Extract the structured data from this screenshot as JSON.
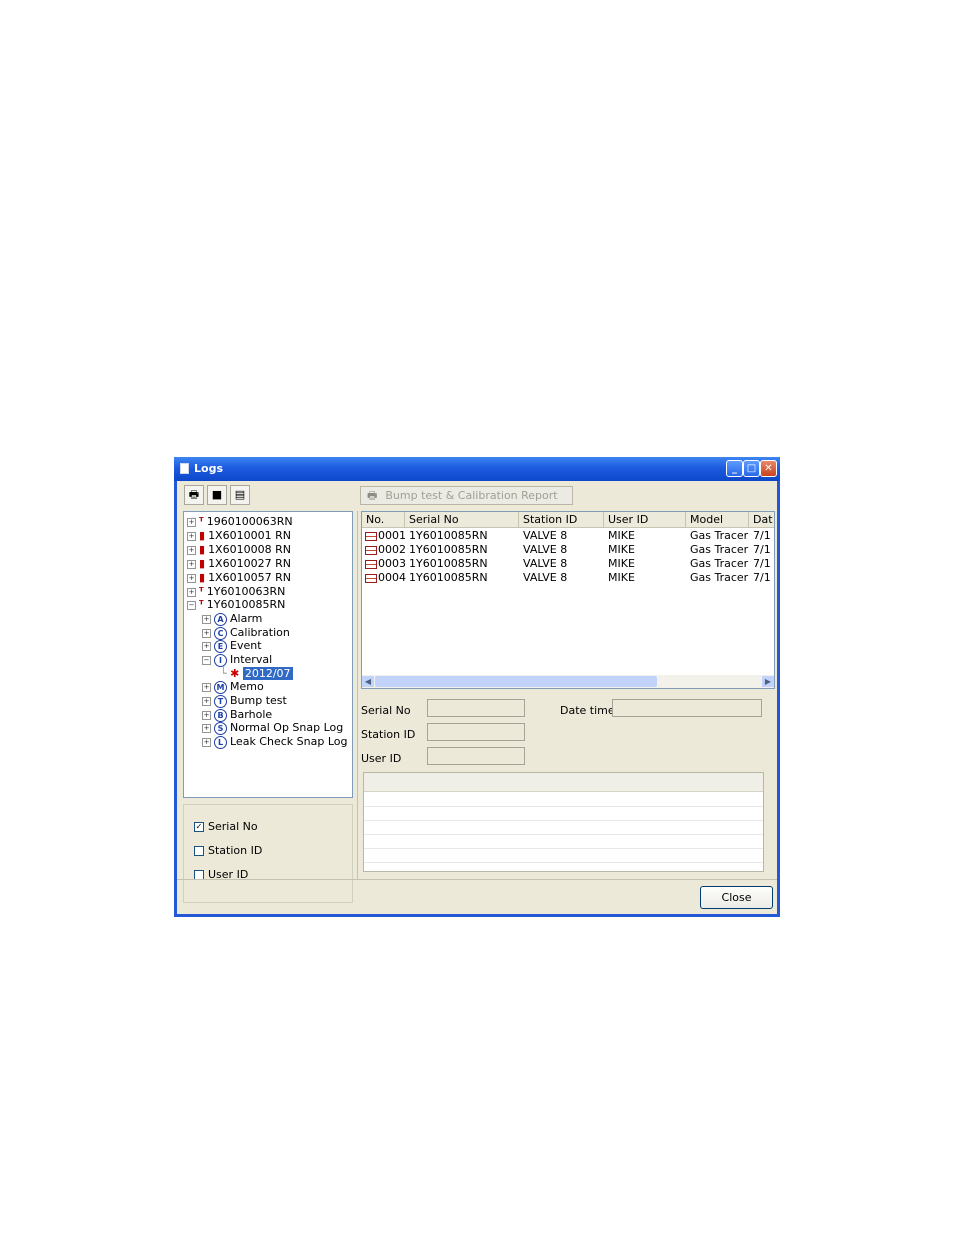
{
  "window": {
    "title": "Logs",
    "minimize": "_",
    "maximize": "□",
    "close": "✕"
  },
  "toolbar": {
    "print_icon": "print-icon",
    "save_icon": "save-icon",
    "clipboard_icon": "clipboard-icon",
    "report_button": "Bump test & Calibration Report"
  },
  "tree": {
    "devices": [
      "1960100063RN",
      "1X6010001 RN",
      "1X6010008 RN",
      "1X6010027 RN",
      "1X6010057 RN",
      "1Y6010063RN",
      "1Y6010085RN"
    ],
    "categories": [
      {
        "letter": "A",
        "label": "Alarm"
      },
      {
        "letter": "C",
        "label": "Calibration"
      },
      {
        "letter": "E",
        "label": "Event"
      },
      {
        "letter": "I",
        "label": "Interval"
      },
      {
        "letter": "M",
        "label": "Memo"
      },
      {
        "letter": "T",
        "label": "Bump test"
      },
      {
        "letter": "B",
        "label": "Barhole"
      },
      {
        "letter": "S",
        "label": "Normal Op Snap Log"
      },
      {
        "letter": "L",
        "label": "Leak Check Snap Log"
      }
    ],
    "selected_leaf": "2012/07"
  },
  "filters": [
    {
      "label": "Serial No",
      "checked": true
    },
    {
      "label": "Station ID",
      "checked": false
    },
    {
      "label": "User ID",
      "checked": false
    }
  ],
  "list": {
    "headers": [
      "No.",
      "Serial No",
      "Station ID",
      "User ID",
      "Model",
      "Dat"
    ],
    "rows": [
      [
        "0001",
        "1Y6010085RN",
        "VALVE 8",
        "MIKE",
        "Gas Tracer",
        "7/1"
      ],
      [
        "0002",
        "1Y6010085RN",
        "VALVE 8",
        "MIKE",
        "Gas Tracer",
        "7/1"
      ],
      [
        "0003",
        "1Y6010085RN",
        "VALVE 8",
        "MIKE",
        "Gas Tracer",
        "7/1"
      ],
      [
        "0004",
        "1Y6010085RN",
        "VALVE 8",
        "MIKE",
        "Gas Tracer",
        "7/1"
      ]
    ]
  },
  "details": {
    "serial_label": "Serial No",
    "station_label": "Station ID",
    "user_label": "User ID",
    "date_label": "Date time"
  },
  "footer": {
    "close_label": "Close"
  }
}
